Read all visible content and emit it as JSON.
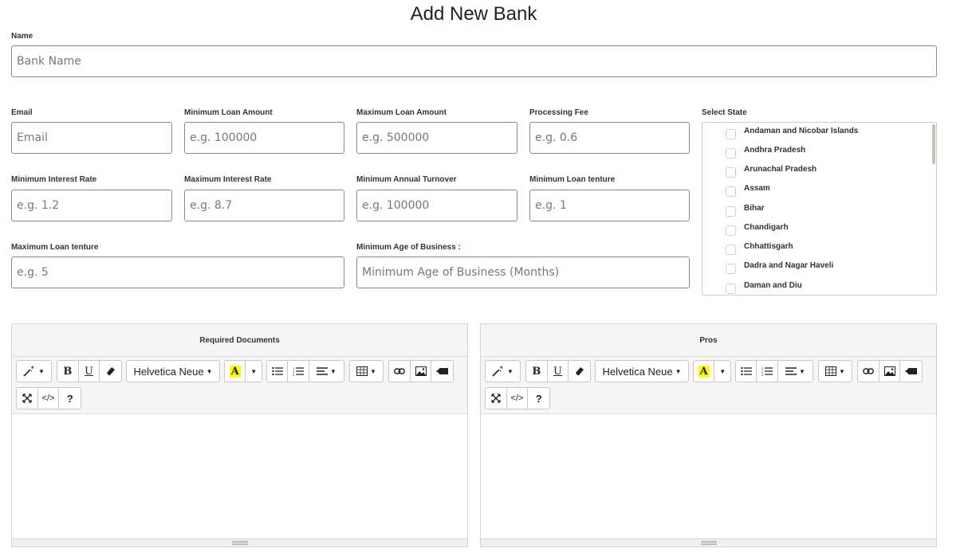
{
  "page": {
    "title": "Add New Bank"
  },
  "form": {
    "name": {
      "label": "Name",
      "placeholder": "Bank Name"
    },
    "email": {
      "label": "Email",
      "placeholder": "Email"
    },
    "min_loan_amount": {
      "label": "Minimum Loan Amount",
      "placeholder": "e.g. 100000"
    },
    "max_loan_amount": {
      "label": "Maximum Loan Amount",
      "placeholder": "e.g. 500000"
    },
    "processing_fee": {
      "label": "Processing Fee",
      "placeholder": "e.g. 0.6"
    },
    "min_interest_rate": {
      "label": "Minimum Interest Rate",
      "placeholder": "e.g. 1.2"
    },
    "max_interest_rate": {
      "label": "Maximum Interest Rate",
      "placeholder": "e.g. 8.7"
    },
    "min_annual_turnover": {
      "label": "Minimum Annual Turnover",
      "placeholder": "e.g. 100000"
    },
    "min_loan_tenure": {
      "label": "Minimum Loan tenture",
      "placeholder": "e.g. 1"
    },
    "max_loan_tenure": {
      "label": "Maximum Loan tenture",
      "placeholder": "e.g. 5"
    },
    "min_age_business": {
      "label": "Minimum Age of Business :",
      "placeholder": "Minimum Age of Business (Months)"
    }
  },
  "states": {
    "label": "Select State",
    "items": [
      "Andaman and Nicobar Islands",
      "Andhra Pradesh",
      "Arunachal Pradesh",
      "Assam",
      "Bihar",
      "Chandigarh",
      "Chhattisgarh",
      "Dadra and Nagar Haveli",
      "Daman and Diu"
    ]
  },
  "editors": {
    "required_docs": {
      "title": "Required Documents"
    },
    "pros": {
      "title": "Pros"
    },
    "toolbar": {
      "font_name": "Helvetica Neue",
      "bold": "B",
      "underline": "U",
      "highlight": "A",
      "codeview": "</>",
      "help": "?"
    }
  },
  "icons": {
    "magic": "magic-wand-icon",
    "eraser": "eraser-icon",
    "ul": "unordered-list-icon",
    "ol": "ordered-list-icon",
    "align": "align-icon",
    "table": "table-icon",
    "link": "link-icon",
    "image": "image-icon",
    "video": "video-icon",
    "fullscreen": "fullscreen-icon"
  }
}
